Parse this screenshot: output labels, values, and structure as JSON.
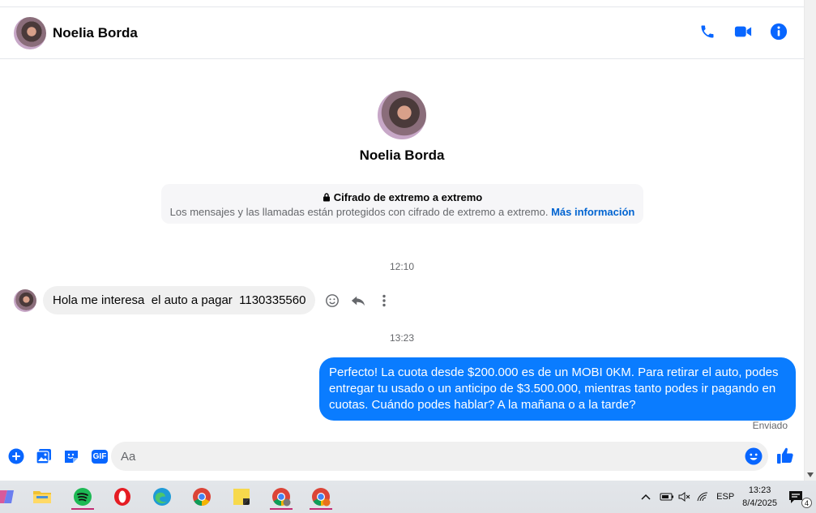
{
  "contact": {
    "name": "Noelia Borda"
  },
  "header": {
    "call_icon": "phone-icon",
    "video_icon": "video-icon",
    "info_icon": "info-icon"
  },
  "encryption": {
    "title": "Cifrado de extremo a extremo",
    "description": "Los mensajes y las llamadas están protegidos con cifrado de extremo a extremo.",
    "link": "Más información"
  },
  "messages": [
    {
      "time": "12:10",
      "direction": "in",
      "text": "Hola me interesa  el auto a pagar  1130335560"
    },
    {
      "time": "13:23",
      "direction": "out",
      "text": "Perfecto! La cuota desde $200.000 es de un MOBI 0KM. Para retirar el auto, podes entregar tu usado o un anticipo de $3.500.000, mientras tanto podes ir pagando en cuotas. Cuándo podes hablar? A la mañana o a la tarde?",
      "status": "Enviado"
    }
  ],
  "composer": {
    "placeholder": "Aa",
    "gif_label": "GIF"
  },
  "colors": {
    "accent": "#0a7cff",
    "link": "#0064d1",
    "icon_blue": "#0866ff"
  },
  "taskbar": {
    "language": "ESP",
    "time": "13:23",
    "date": "8/4/2025",
    "notification_count": "4"
  }
}
